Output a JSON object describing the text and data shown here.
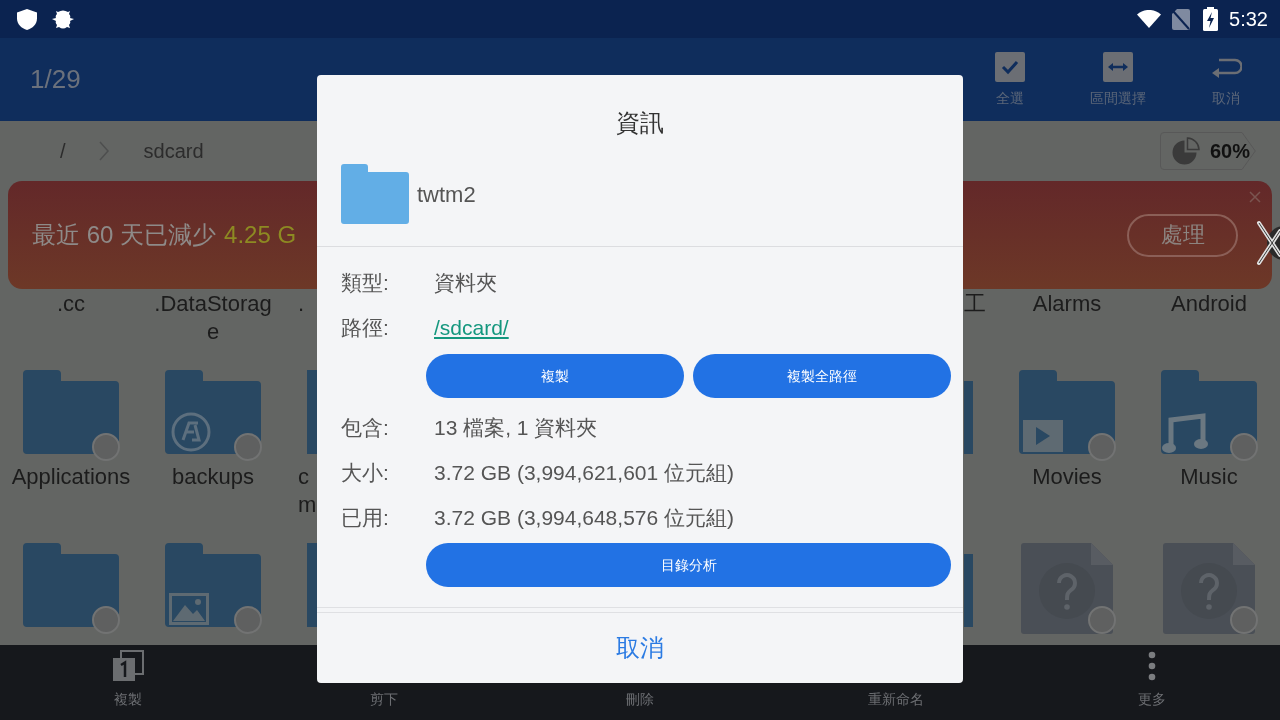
{
  "status_bar": {
    "time": "5:32"
  },
  "app_bar": {
    "counter": "1/29",
    "actions": [
      {
        "kind": "select_all",
        "label": "全選"
      },
      {
        "kind": "range",
        "label": "區間選擇"
      },
      {
        "kind": "undo",
        "label": "取消"
      }
    ]
  },
  "breadcrumb": {
    "items": [
      "/",
      "sdcard"
    ],
    "storage": "60%"
  },
  "banner": {
    "text": "最近 60 天已減少",
    "highlight": "4.25 G",
    "button": "處理"
  },
  "files": [
    {
      "left": [
        {
          "label": ".cc"
        },
        {
          "label": ".DataStorage"
        },
        {
          "label": "."
        }
      ],
      "right": [
        {
          "label": "工"
        },
        {
          "label": "Alarms"
        },
        {
          "label": "Android"
        }
      ]
    },
    {
      "left": [
        {
          "kind": "folder",
          "label": "Applications",
          "selected": false
        },
        {
          "kind": "backup",
          "label": "backups",
          "selected": false
        },
        {
          "kind": "folder",
          "label": "c m"
        }
      ],
      "right": [
        {
          "kind": "folder"
        },
        {
          "kind": "video",
          "label": "Movies",
          "selected": false
        },
        {
          "kind": "music",
          "label": "Music",
          "selected": false
        }
      ]
    },
    {
      "left": [
        {
          "kind": "folder",
          "selected": false
        },
        {
          "kind": "picture",
          "selected": false
        },
        {
          "kind": "folder"
        }
      ],
      "right": [
        {
          "kind": "folder"
        },
        {
          "kind": "unknown",
          "selected": false
        },
        {
          "kind": "unknown",
          "selected": false
        }
      ]
    }
  ],
  "bottom_bar": [
    {
      "kind": "copy",
      "label": "複製"
    },
    {
      "kind": "cut",
      "label": "剪下"
    },
    {
      "kind": "delete",
      "label": "刪除"
    },
    {
      "kind": "rename",
      "label": "重新命名"
    },
    {
      "kind": "more",
      "label": "更多"
    }
  ],
  "dialog": {
    "title": "資訊",
    "name": "twtm2",
    "fields": [
      {
        "kind": "text",
        "label": "類型:",
        "value": "資料夾"
      },
      {
        "kind": "link",
        "label": "路徑:",
        "value": "/sdcard/",
        "buttons": [
          "複製",
          "複製全路徑"
        ]
      },
      {
        "kind": "text",
        "label": "包含:",
        "value": "13 檔案, 1 資料夾"
      },
      {
        "kind": "text",
        "label": "大小:",
        "value": "3.72 GB (3,994,621,601 位元組)"
      },
      {
        "kind": "text",
        "label": "已用:",
        "value": "3.72 GB (3,994,648,576 位元組)"
      }
    ],
    "analyze_button": "目錄分析",
    "cancel": "取消"
  }
}
